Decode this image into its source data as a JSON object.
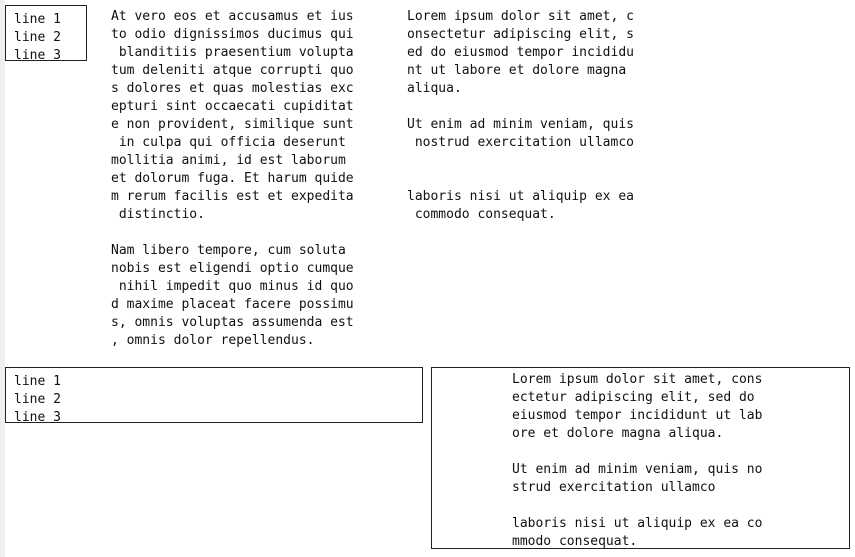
{
  "small_box": {
    "lines": [
      "line 1",
      "line 2",
      "line 3"
    ]
  },
  "wide_box": {
    "lines": [
      "line 1",
      "line 2",
      "line 3"
    ]
  },
  "middle_text": {
    "paragraphs": [
      "At vero eos et accusamus et ius\nto odio dignissimos ducimus qui\n blanditiis praesentium volupta\ntum deleniti atque corrupti quo\ns dolores et quas molestias exc\nepturi sint occaecati cupiditat\ne non provident, similique sunt\n in culpa qui officia deserunt\nmollitia animi, id est laborum\net dolorum fuga. Et harum quide\nm rerum facilis est et expedita\n distinctio.",
      "Nam libero tempore, cum soluta\nnobis est eligendi optio cumque\n nihil impedit quo minus id quo\nd maxime placeat facere possimu\ns, omnis voluptas assumenda est\n, omnis dolor repellendus."
    ]
  },
  "right_text": {
    "paragraphs": [
      "Lorem ipsum dolor sit amet, c\nonsectetur adipiscing elit, s\ned do eiusmod tempor incididu\nnt ut labore et dolore magna\naliqua.",
      "Ut enim ad minim veniam, quis\n nostrud exercitation ullamco",
      "laboris nisi ut aliquip ex ea\n commodo consequat."
    ]
  },
  "bottom_right_box": {
    "paragraphs": [
      "Lorem ipsum dolor sit amet, cons\nectetur adipiscing elit, sed do\neiusmod tempor incididunt ut lab\nore et dolore magna aliqua.",
      "Ut enim ad minim veniam, quis no\nstrud exercitation ullamco",
      "laboris nisi ut aliquip ex ea co\nmmodo consequat."
    ]
  }
}
